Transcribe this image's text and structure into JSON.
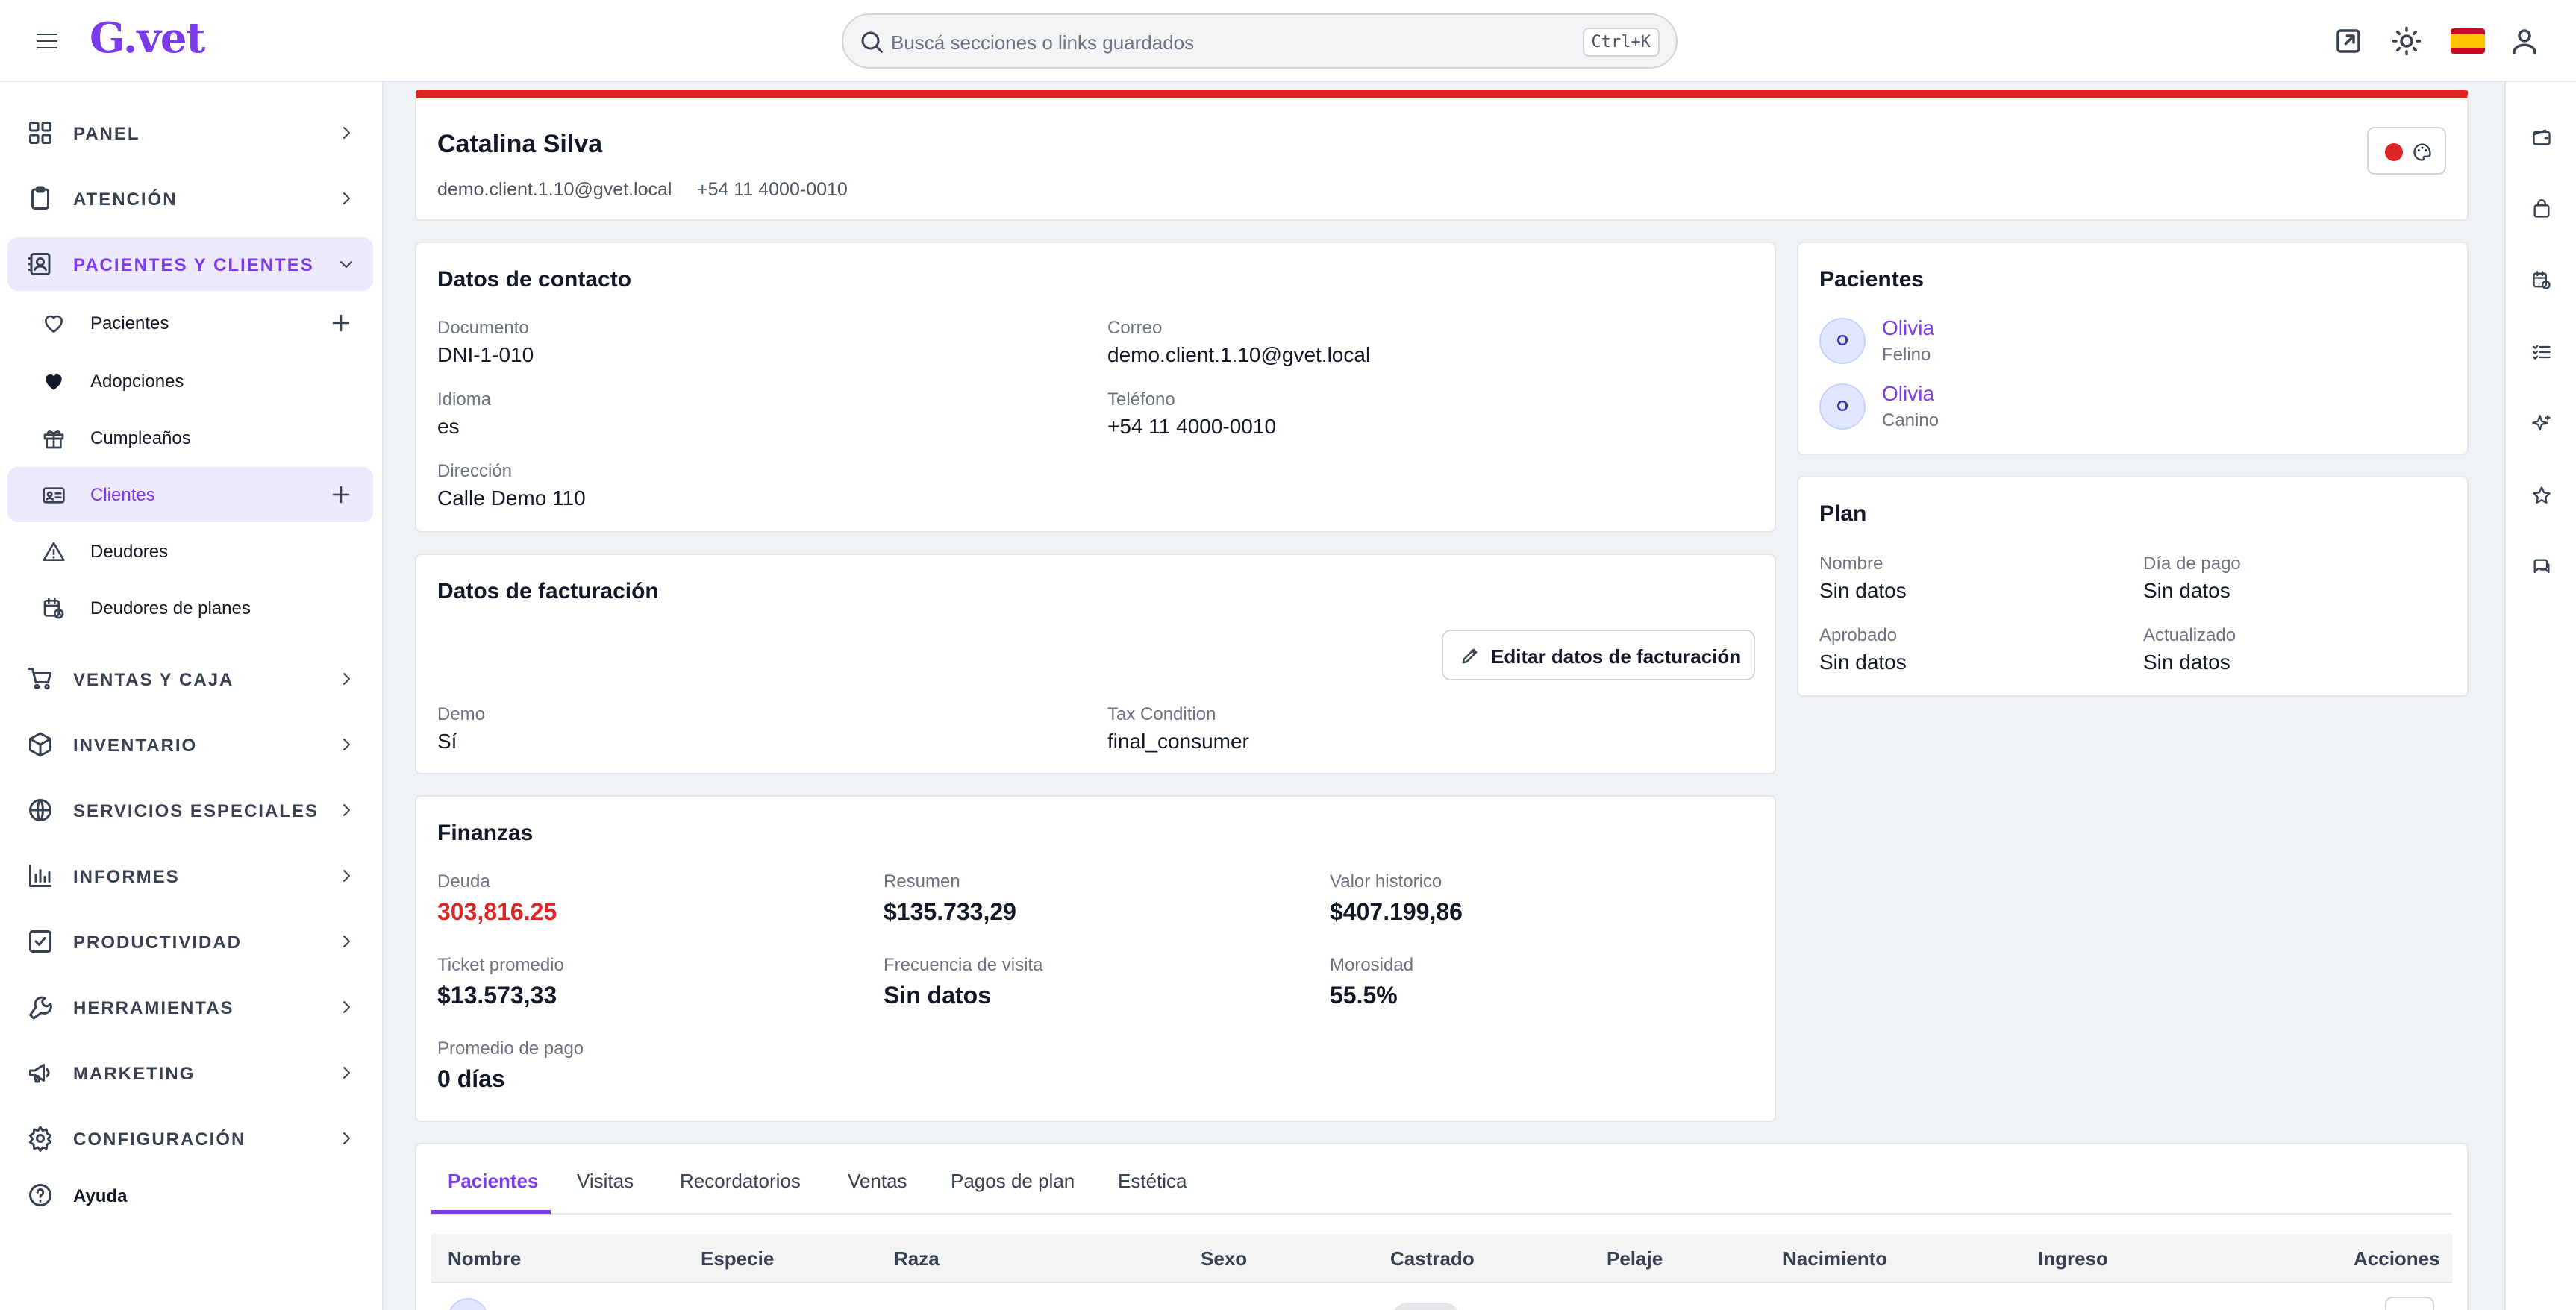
{
  "app": {
    "logo": "G.vet"
  },
  "search": {
    "placeholder": "Buscá secciones o links guardados",
    "shortcut": "Ctrl+K"
  },
  "sidebar": {
    "items": [
      {
        "label": "PANEL",
        "icon": "grid-icon"
      },
      {
        "label": "ATENCIÓN",
        "icon": "clipboard-icon"
      },
      {
        "label": "PACIENTES Y CLIENTES",
        "icon": "contacts-icon"
      },
      {
        "label": "VENTAS Y CAJA",
        "icon": "cart-icon"
      },
      {
        "label": "INVENTARIO",
        "icon": "box-icon"
      },
      {
        "label": "SERVICIOS ESPECIALES",
        "icon": "globe-icon"
      },
      {
        "label": "INFORMES",
        "icon": "bar-chart-icon"
      },
      {
        "label": "PRODUCTIVIDAD",
        "icon": "check-square-icon"
      },
      {
        "label": "HERRAMIENTAS",
        "icon": "wrench-icon"
      },
      {
        "label": "MARKETING",
        "icon": "megaphone-icon"
      },
      {
        "label": "CONFIGURACIÓN",
        "icon": "gear-icon"
      },
      {
        "label": "Ayuda",
        "icon": "help-icon"
      }
    ],
    "subitems": [
      {
        "label": "Pacientes",
        "icon": "heart-outline-icon"
      },
      {
        "label": "Adopciones",
        "icon": "heart-filled-icon"
      },
      {
        "label": "Cumpleaños",
        "icon": "gift-icon"
      },
      {
        "label": "Clientes",
        "icon": "id-card-icon"
      },
      {
        "label": "Deudores",
        "icon": "warning-icon"
      },
      {
        "label": "Deudores de planes",
        "icon": "calendar-clock-icon"
      }
    ]
  },
  "client": {
    "name": "Catalina Silva",
    "email": "demo.client.1.10@gvet.local",
    "phone": "+54 11 4000-0010"
  },
  "contact": {
    "title": "Datos de contacto",
    "documento_label": "Documento",
    "documento": "DNI-1-010",
    "correo_label": "Correo",
    "correo": "demo.client.1.10@gvet.local",
    "idioma_label": "Idioma",
    "idioma": "es",
    "telefono_label": "Teléfono",
    "telefono": "+54 11 4000-0010",
    "direccion_label": "Dirección",
    "direccion": "Calle Demo 110"
  },
  "billing": {
    "title": "Datos de facturación",
    "edit_button": "Editar datos de facturación",
    "demo_label": "Demo",
    "demo": "Sí",
    "tax_label": "Tax Condition",
    "tax": "final_consumer"
  },
  "finance": {
    "title": "Finanzas",
    "deuda_label": "Deuda",
    "deuda": "303,816.25",
    "resumen_label": "Resumen",
    "resumen": "$135.733,29",
    "historico_label": "Valor historico",
    "historico": "$407.199,86",
    "ticket_label": "Ticket promedio",
    "ticket": "$13.573,33",
    "frecuencia_label": "Frecuencia de visita",
    "frecuencia": "Sin datos",
    "morosidad_label": "Morosidad",
    "morosidad": "55.5%",
    "promedio_label": "Promedio de pago",
    "promedio": "0 días"
  },
  "patients": {
    "title": "Pacientes",
    "list": [
      {
        "initial": "O",
        "name": "Olivia",
        "species": "Felino"
      },
      {
        "initial": "O",
        "name": "Olivia",
        "species": "Canino"
      }
    ]
  },
  "plan": {
    "title": "Plan",
    "nombre_label": "Nombre",
    "nombre": "Sin datos",
    "dia_label": "Día de pago",
    "dia": "Sin datos",
    "aprobado_label": "Aprobado",
    "aprobado": "Sin datos",
    "actualizado_label": "Actualizado",
    "actualizado": "Sin datos"
  },
  "tabs": [
    "Pacientes",
    "Visitas",
    "Recordatorios",
    "Ventas",
    "Pagos de plan",
    "Estética"
  ],
  "table": {
    "columns": [
      "Nombre",
      "Especie",
      "Raza",
      "Sexo",
      "Castrado",
      "Pelaje",
      "Nacimiento",
      "Ingreso",
      "Acciones"
    ]
  },
  "colors": {
    "accent": "#7c3aed",
    "danger": "#dc2626",
    "banner": "#dc2626"
  }
}
